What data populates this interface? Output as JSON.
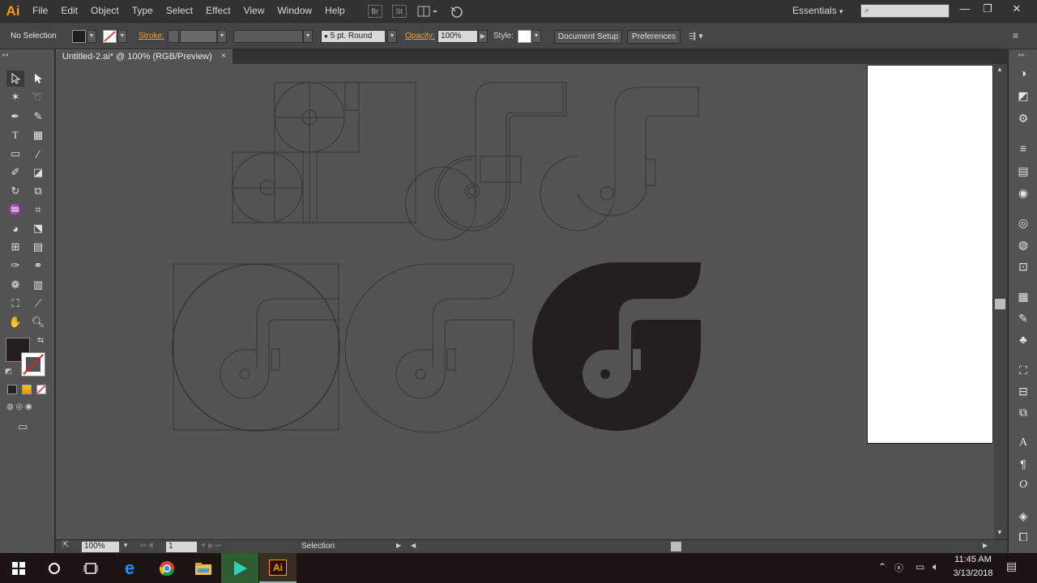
{
  "app": {
    "logo": "Ai",
    "accent": "#ff9a00"
  },
  "menu": [
    "File",
    "Edit",
    "Object",
    "Type",
    "Select",
    "Effect",
    "View",
    "Window",
    "Help"
  ],
  "menubar_icons": {
    "bridge": "Br",
    "stock": "St"
  },
  "workspace": {
    "label": "Essentials",
    "search_placeholder": ""
  },
  "window_controls": {
    "minimize": "—",
    "restore": "❐",
    "close": "✕"
  },
  "control_bar": {
    "selection_label": "No Selection",
    "stroke_label": "Stroke:",
    "brush_value": "5 pt. Round",
    "opacity_label": "Opacity:",
    "opacity_value": "100%",
    "style_label": "Style:",
    "document_setup": "Document Setup",
    "preferences": "Preferences"
  },
  "document_tab": {
    "title": "Untitled-2.ai* @ 100% (RGB/Preview)",
    "close": "×"
  },
  "status_bar": {
    "zoom": "100%",
    "artboard": "1",
    "tool": "Selection"
  },
  "taskbar": {
    "time": "11:45 AM",
    "date": "3/13/2018"
  },
  "colors": {
    "fill": "#231f20",
    "canvas": "#535353",
    "artwork_stroke": "#3a3a3a"
  }
}
